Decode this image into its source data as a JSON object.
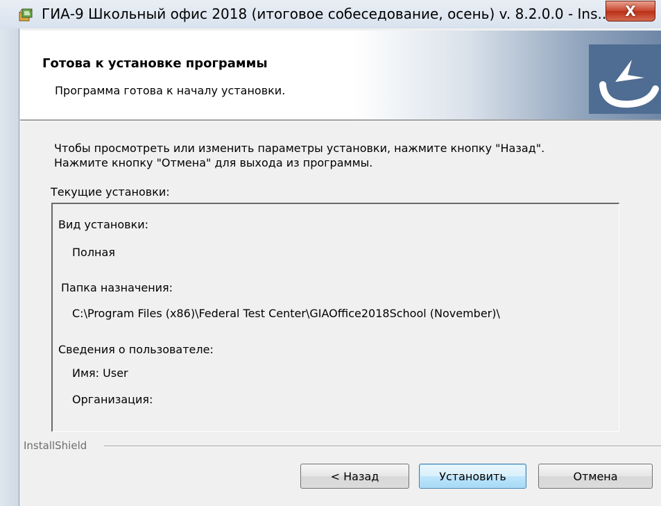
{
  "window": {
    "title": "ГИА-9 Школьный офис 2018 (итоговое собеседование, осень) v. 8.2.0.0 - Ins...",
    "close_label": "X"
  },
  "header": {
    "title": "Готова к установке программы",
    "subtitle": "Программа готова к началу установки."
  },
  "body": {
    "instruction_1": "Чтобы просмотреть или изменить параметры установки, нажмите кнопку \"Назад\".",
    "instruction_2": "Нажмите кнопку \"Отмена\" для выхода из программы.",
    "current_settings_label": "Текущие установки:",
    "settings": {
      "install_type_label": "Вид установки:",
      "install_type_value": "Полная",
      "destination_label": "Папка назначения:",
      "destination_value": "C:\\Program Files (x86)\\Federal Test Center\\GIAOffice2018School (November)\\",
      "user_info_label": "Сведения о пользователе:",
      "user_name": "Имя: User",
      "organization": "Организация:"
    }
  },
  "footer": {
    "brand": "InstallShield",
    "back_label": "< Назад",
    "install_label": "Установить",
    "cancel_label": "Отмена"
  },
  "colors": {
    "logo_bg": "#4f6c92",
    "close_button": "#c7432c",
    "default_button_border": "#3c7fb1"
  },
  "icons": {
    "title_icon": "installer-box-icon",
    "logo": "installshield-logo-icon",
    "close": "close-icon"
  }
}
